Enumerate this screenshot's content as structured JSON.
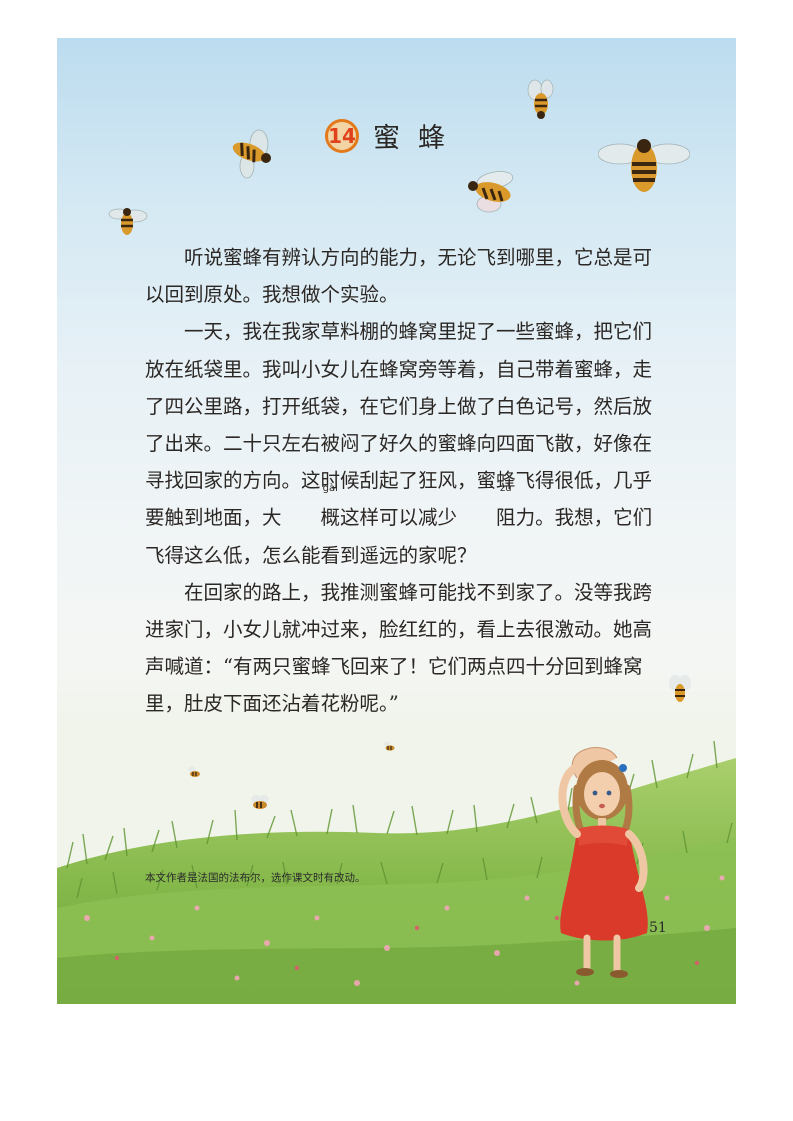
{
  "lesson": {
    "number": "14",
    "title": "蜜蜂"
  },
  "body": {
    "p1": "听说蜜蜂有辨认方向的能力，无论飞到哪里，它总是可以回到原处。我想做个实验。",
    "p2_a": "一天，我在我家草料棚的蜂窝里捉了一些蜜蜂，把它们放在纸袋里。我叫小女儿在蜂窝旁等着，自己带着蜜蜂，走了四公里路，打开纸袋，在它们身上做了白色记号，然后放了出来。二十只左右被闷了好久的蜜蜂向四面飞散，好像在寻找回家的方向。这时候刮起了狂风，蜜蜂飞得很低，几乎要触到地面，大",
    "ruby1": {
      "char": "概",
      "pinyin": "gài"
    },
    "p2_b": "这样可以减少",
    "ruby2": {
      "char": "阻",
      "pinyin": "zǔ"
    },
    "p2_c": "力。我想，它们飞得这么低，怎么能看到遥远的家呢？",
    "p3": "在回家的路上，我推测蜜蜂可能找不到家了。没等我跨进家门，小女儿就冲过来，脸红红的，看上去很激动。她高声喊道：“有两只蜜蜂飞回来了！它们两点四十分回到蜂窝里，肚皮下面还沾着花粉呢。”"
  },
  "footnote": "本文作者是法国的法布尔，选作课文时有改动。",
  "page_number": "51",
  "colors": {
    "accent": "#e27a1c",
    "sky": "#bcdcef",
    "grass": "#7fb24a",
    "dress": "#d93a2a"
  }
}
